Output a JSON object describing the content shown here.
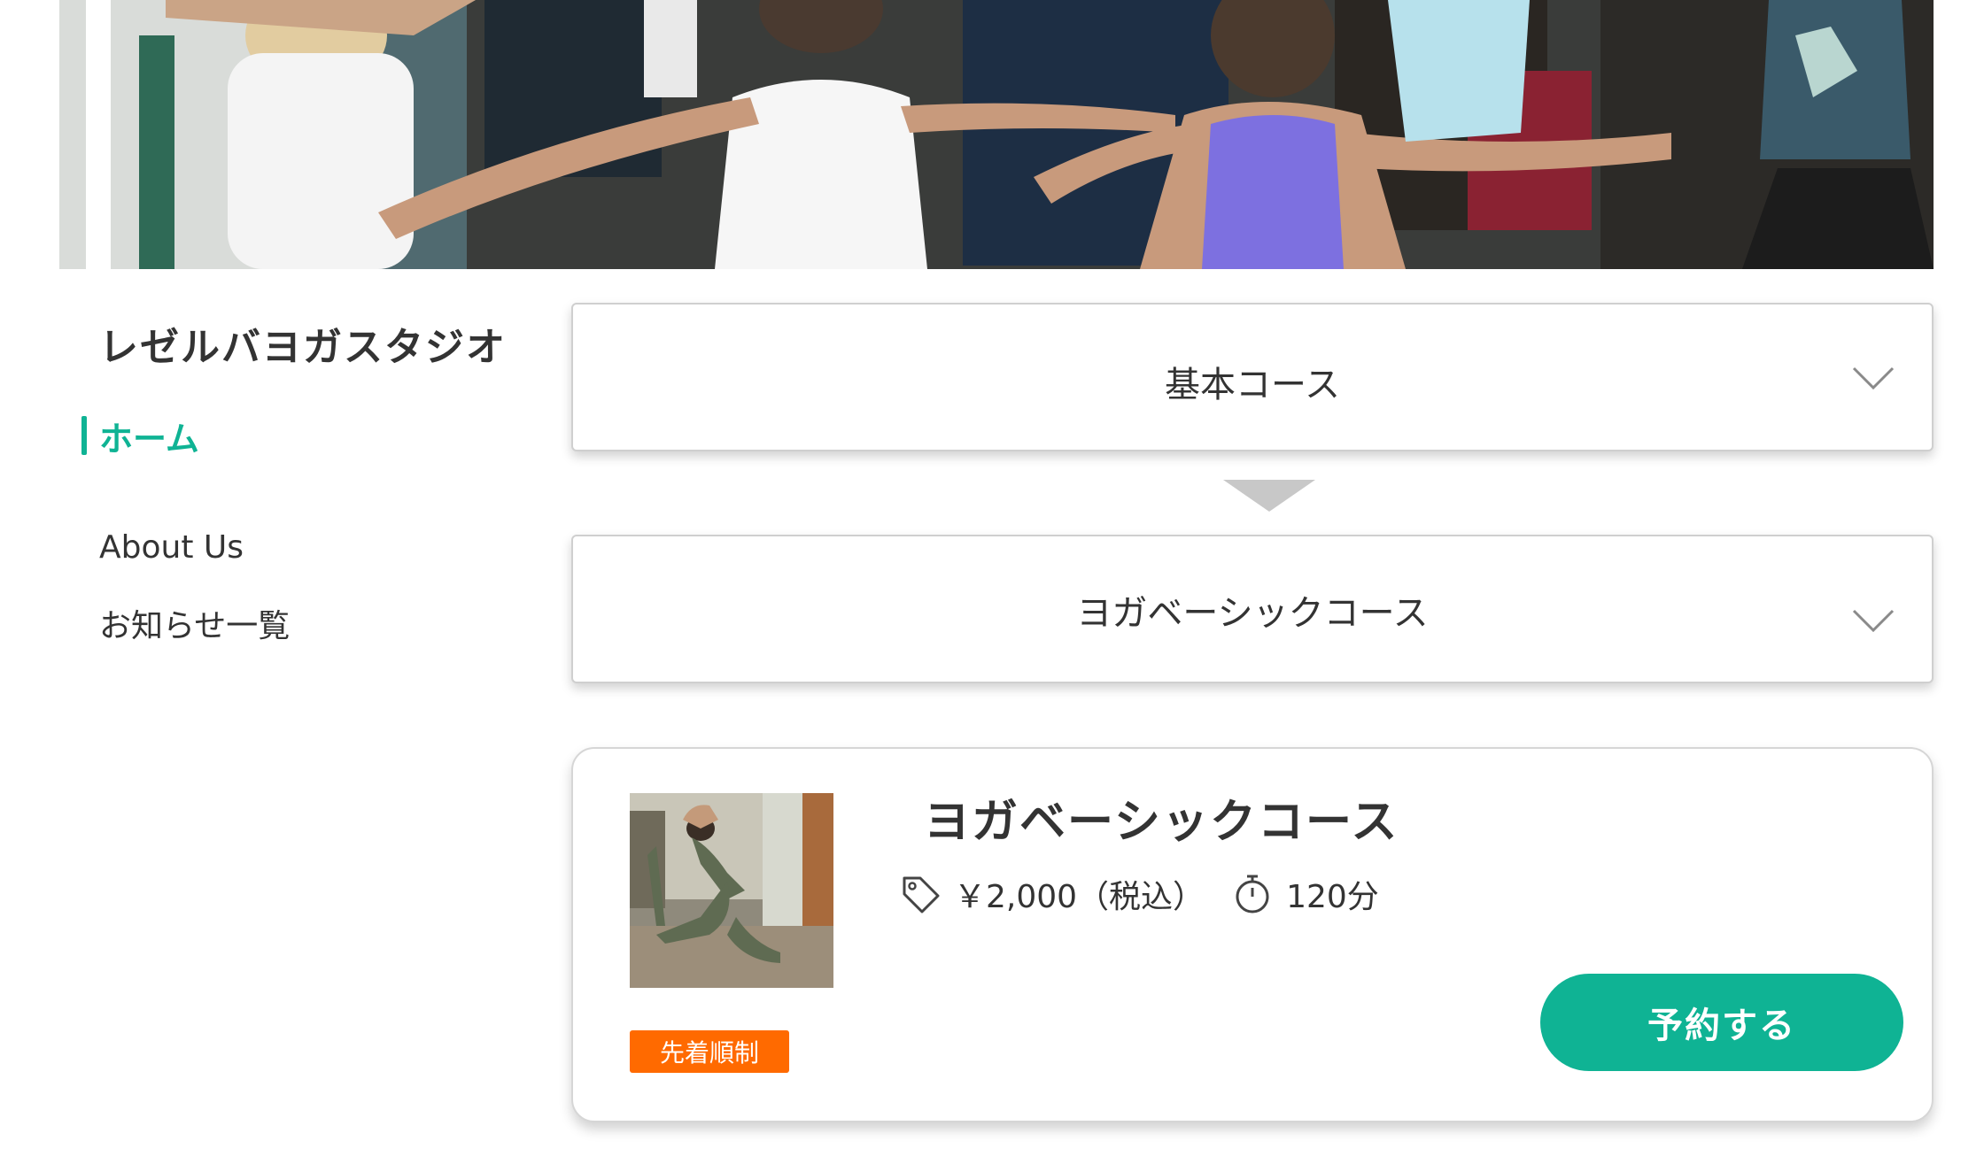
{
  "hero": {
    "image": "yoga-class-hero-photo"
  },
  "sidebar": {
    "studio_name": "レゼルバヨガスタジオ",
    "active_item": "ホーム",
    "items": [
      "About Us",
      "お知らせ一覧"
    ]
  },
  "course_selects": [
    {
      "value": "基本コース",
      "icon": "chevron-down-icon"
    },
    {
      "value": "ヨガベーシックコース",
      "icon": "chevron-down-icon"
    }
  ],
  "course_card": {
    "image": "yoga-pose-thumbnail",
    "title": "ヨガベーシックコース",
    "price": "￥2,000（税込）",
    "price_icon": "tag-icon",
    "duration": "120分",
    "duration_icon": "stopwatch-icon",
    "badge": "先着順制",
    "reserve_label": "予約する"
  },
  "colors": {
    "accent": "#0fb394",
    "badge": "#ff6a00",
    "text": "#333333",
    "border": "#cfcfcf"
  }
}
